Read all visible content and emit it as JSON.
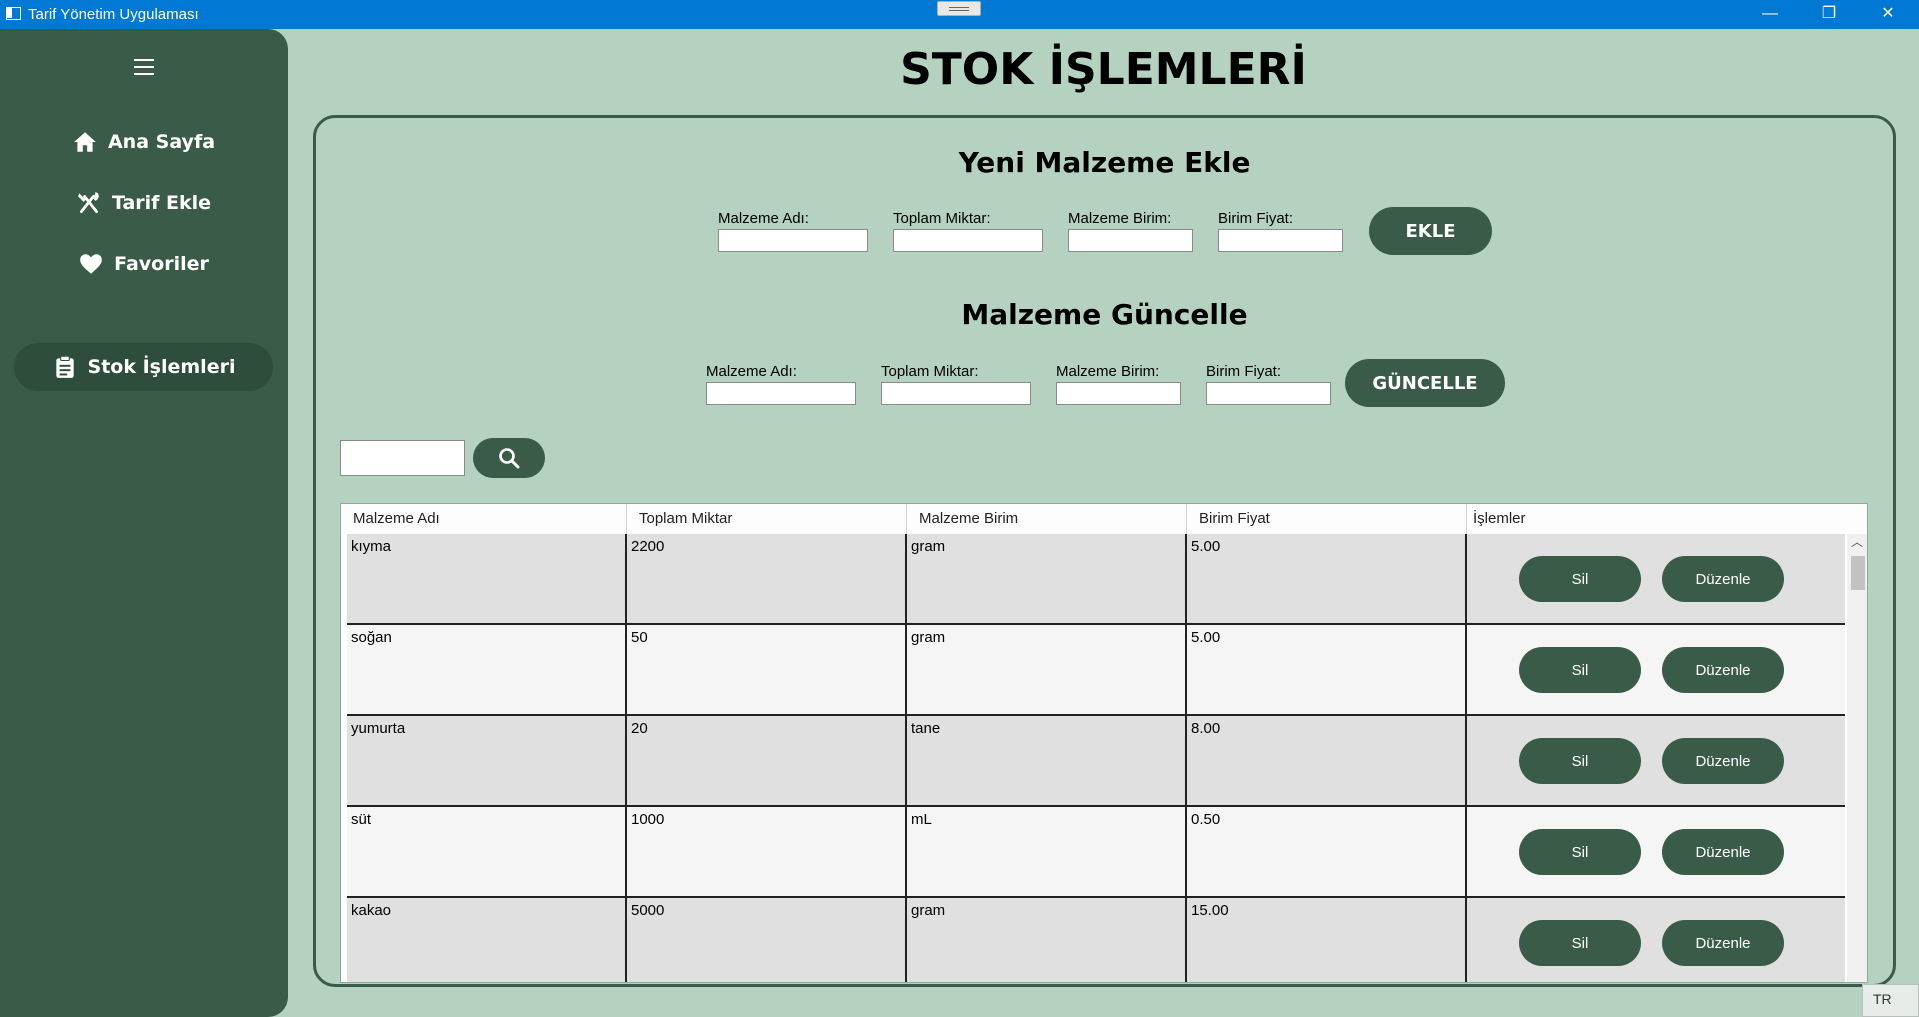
{
  "window": {
    "title": "Tarif Yönetim Uygulaması",
    "minimize": "—",
    "restore": "❐",
    "close": "✕"
  },
  "sidebar": {
    "items": [
      {
        "label": "Ana Sayfa",
        "icon": "home-icon"
      },
      {
        "label": "Tarif Ekle",
        "icon": "utensils-icon"
      },
      {
        "label": "Favoriler",
        "icon": "heart-icon"
      },
      {
        "label": "Stok İşlemleri",
        "icon": "clipboard-icon",
        "active": true
      }
    ]
  },
  "page": {
    "title": "STOK İŞLEMLERİ"
  },
  "add_form": {
    "title": "Yeni Malzeme Ekle",
    "labels": {
      "name": "Malzeme Adı:",
      "total": "Toplam Miktar:",
      "unit": "Malzeme Birim:",
      "price": "Birim Fiyat:"
    },
    "button": "EKLE"
  },
  "update_form": {
    "title": "Malzeme Güncelle",
    "labels": {
      "name": "Malzeme Adı:",
      "total": "Toplam Miktar:",
      "unit": "Malzeme Birim:",
      "price": "Birim Fiyat:"
    },
    "button": "GÜNCELLE"
  },
  "search": {
    "value": "",
    "icon": "search-icon"
  },
  "table": {
    "headers": [
      "Malzeme Adı",
      "Toplam Miktar",
      "Malzeme Birim",
      "Birim Fiyat",
      "İşlemler"
    ],
    "rows": [
      {
        "name": "kıyma",
        "total": "2200",
        "unit": "gram",
        "price": "5.00"
      },
      {
        "name": "soğan",
        "total": "50",
        "unit": "gram",
        "price": "5.00"
      },
      {
        "name": "yumurta",
        "total": "20",
        "unit": "tane",
        "price": "8.00"
      },
      {
        "name": "süt",
        "total": "1000",
        "unit": "mL",
        "price": "0.50"
      },
      {
        "name": "kakao",
        "total": "5000",
        "unit": "gram",
        "price": "15.00"
      }
    ],
    "delete_label": "Sil",
    "edit_label": "Düzenle"
  },
  "taskbar": {
    "language": "TR"
  },
  "colors": {
    "background": "#b5d2c1",
    "sidebar": "#3a5b48",
    "accent": "#3a5b48",
    "titlebar": "#0078d4"
  }
}
